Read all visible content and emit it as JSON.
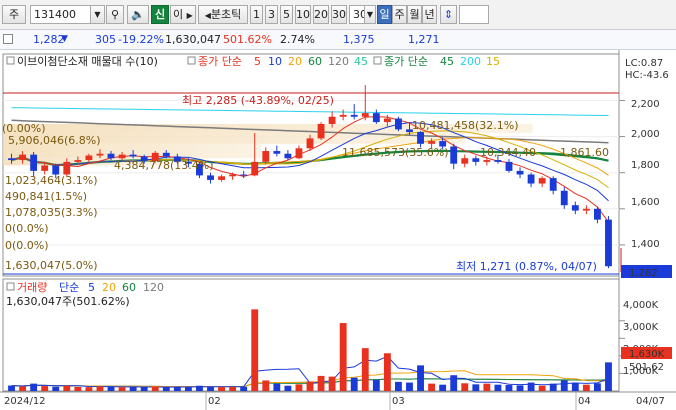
{
  "toolbar": {
    "market_label": "주",
    "code_value": "131400",
    "mode_new": "신",
    "mode_same": "이",
    "period_label": "분초틱",
    "intervals": [
      "1",
      "3",
      "5",
      "10",
      "20",
      "30"
    ],
    "interval_value": "30",
    "period_day": "일",
    "period_week": "주",
    "period_month": "월",
    "period_year": "년"
  },
  "quote": {
    "price": "1,282",
    "change": "305",
    "change_pct": "-19.22%",
    "volume": "1,630,047",
    "volume_ratio": "501.62%",
    "turnover": "2.74%",
    "open": "1,375",
    "low": "1,271"
  },
  "price_panel": {
    "legend_title": "이브이첨단소재 매물대 수(10)",
    "ma_label": "종가 단순",
    "ma_periods": [
      "5",
      "10",
      "20",
      "60",
      "120",
      "45"
    ],
    "ma_colors": [
      "#e8311f",
      "#1a3bd8",
      "#f0a30a",
      "#14843d",
      "#7b7b7b",
      "#2cc6a0"
    ],
    "ma2_label": "종가 단순",
    "ma2_periods": [
      "45",
      "200",
      "15"
    ],
    "ma2_colors": [
      "#14843d",
      "#2ad0ee",
      "#d4b000"
    ],
    "lc_label": "LC:0.87",
    "hc_label": "HC:-43.6",
    "high_annotation": "최고 2,285 (-43.89%, 02/25)",
    "low_annotation": "최저 1,271 (0.87%, 04/07)",
    "price_tag": "1,282",
    "y_ticks": [
      "2,200",
      "2,000",
      "1,800",
      "1,600",
      "1,400"
    ],
    "vp_labels": [
      "5,906,046(6.8%)",
      "4,384,778(13.4%)",
      "1,023,464(3.1%)",
      "490,841(1.5%)",
      "1,078,035(3.3%)",
      "0(0.0%)",
      "0(0.0%)",
      "1,630,047(5.0%)",
      "10,481,458(32.1%)",
      "11,685,573(35.6%)",
      "10,344,40",
      "1,861.60",
      "(0.00%)"
    ]
  },
  "volume_panel": {
    "title": "거래량",
    "ma_label": "단순",
    "ma_periods": [
      "5",
      "20",
      "60",
      "120"
    ],
    "ma_colors": [
      "#1a3bd8",
      "#f0a30a",
      "#14843d",
      "#7b7b7b"
    ],
    "current_text": "1,630,047주(501.62%)",
    "y_ticks": [
      "4,000K",
      "3,000K",
      "2,000K",
      "1,000K"
    ],
    "volume_tag": "1,630K",
    "ratio_tag": "501.62"
  },
  "x_axis": [
    "2024/12",
    "02",
    "03",
    "04",
    "04/07"
  ],
  "chart_data": {
    "type": "candlestick",
    "ylim_price": [
      1250,
      2330
    ],
    "ylim_volume": [
      0,
      4500000
    ],
    "high": {
      "value": 2285,
      "date": "02/25"
    },
    "low": {
      "value": 1271,
      "date": "04/07"
    },
    "candles": [
      [
        1880,
        1905,
        1850,
        1870
      ],
      [
        1870,
        1920,
        1850,
        1900
      ],
      [
        1900,
        1915,
        1780,
        1810
      ],
      [
        1810,
        1860,
        1790,
        1840
      ],
      [
        1840,
        1850,
        1770,
        1790
      ],
      [
        1790,
        1880,
        1780,
        1860
      ],
      [
        1860,
        1890,
        1840,
        1870
      ],
      [
        1870,
        1905,
        1860,
        1895
      ],
      [
        1895,
        1930,
        1880,
        1905
      ],
      [
        1905,
        1920,
        1870,
        1880
      ],
      [
        1880,
        1915,
        1870,
        1900
      ],
      [
        1900,
        1925,
        1880,
        1890
      ],
      [
        1890,
        1900,
        1850,
        1865
      ],
      [
        1865,
        1920,
        1855,
        1910
      ],
      [
        1910,
        1925,
        1880,
        1890
      ],
      [
        1890,
        1905,
        1850,
        1860
      ],
      [
        1860,
        1880,
        1830,
        1850
      ],
      [
        1850,
        1860,
        1770,
        1785
      ],
      [
        1785,
        1800,
        1740,
        1760
      ],
      [
        1760,
        1790,
        1750,
        1780
      ],
      [
        1780,
        1800,
        1760,
        1790
      ],
      [
        1790,
        1810,
        1770,
        1785
      ],
      [
        1785,
        2020,
        1780,
        1860
      ],
      [
        1860,
        1940,
        1845,
        1920
      ],
      [
        1920,
        1950,
        1890,
        1905
      ],
      [
        1905,
        1925,
        1870,
        1880
      ],
      [
        1880,
        1950,
        1875,
        1935
      ],
      [
        1935,
        2010,
        1920,
        1990
      ],
      [
        1990,
        2080,
        1980,
        2070
      ],
      [
        2070,
        2140,
        2050,
        2110
      ],
      [
        2110,
        2150,
        2090,
        2120
      ],
      [
        2120,
        2180,
        2095,
        2110
      ],
      [
        2110,
        2285,
        2090,
        2130
      ],
      [
        2130,
        2150,
        2070,
        2080
      ],
      [
        2080,
        2120,
        2050,
        2100
      ],
      [
        2100,
        2110,
        2030,
        2040
      ],
      [
        2040,
        2080,
        2010,
        2025
      ],
      [
        2025,
        2030,
        1940,
        1960
      ],
      [
        1960,
        1990,
        1930,
        1975
      ],
      [
        1975,
        1995,
        1930,
        1945
      ],
      [
        1945,
        1960,
        1820,
        1850
      ],
      [
        1850,
        1900,
        1830,
        1880
      ],
      [
        1880,
        1895,
        1840,
        1860
      ],
      [
        1860,
        1890,
        1840,
        1870
      ],
      [
        1870,
        1900,
        1850,
        1860
      ],
      [
        1860,
        1875,
        1800,
        1810
      ],
      [
        1810,
        1830,
        1770,
        1790
      ],
      [
        1790,
        1800,
        1720,
        1740
      ],
      [
        1740,
        1780,
        1720,
        1770
      ],
      [
        1770,
        1780,
        1680,
        1700
      ],
      [
        1700,
        1720,
        1600,
        1620
      ],
      [
        1620,
        1640,
        1570,
        1590
      ],
      [
        1590,
        1620,
        1570,
        1600
      ],
      [
        1600,
        1610,
        1520,
        1540
      ],
      [
        1540,
        1560,
        1271,
        1282
      ]
    ],
    "volumes": [
      310000,
      260000,
      420000,
      280000,
      240000,
      300000,
      230000,
      220000,
      260000,
      240000,
      210000,
      230000,
      200000,
      260000,
      220000,
      240000,
      210000,
      300000,
      250000,
      220000,
      230000,
      240000,
      4650000,
      600000,
      420000,
      300000,
      380000,
      540000,
      860000,
      820000,
      3870000,
      760000,
      2440000,
      640000,
      2150000,
      520000,
      480000,
      1460000,
      420000,
      360000,
      900000,
      440000,
      380000,
      420000,
      360000,
      340000,
      320000,
      480000,
      300000,
      420000,
      600000,
      480000,
      360000,
      440000,
      1630047
    ]
  }
}
